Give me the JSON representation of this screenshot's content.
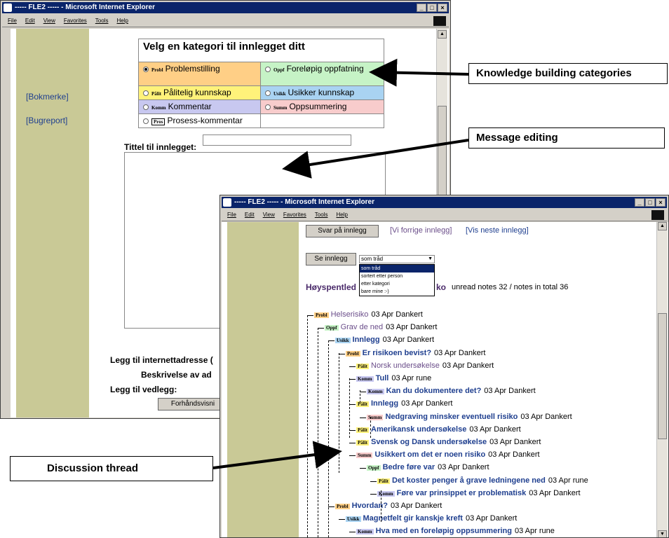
{
  "win1": {
    "title": "----- FLE2 ----- - Microsoft Internet Explorer",
    "menu": [
      "File",
      "Edit",
      "View",
      "Favorites",
      "Tools",
      "Help"
    ],
    "links": [
      "[Bokmerke]",
      "[Bugreport]"
    ],
    "heading": "Velg en kategori til innlegget ditt",
    "categories": [
      {
        "tag": "Probl",
        "label": "Problemstilling",
        "color": "#ffcf86",
        "selected": true
      },
      {
        "tag": "Oppf",
        "label": "Foreløpig oppfatning",
        "color": "#c6f3c6"
      },
      {
        "tag": "Pålit",
        "label": "Pålitelig kunnskap",
        "color": "#fff27a"
      },
      {
        "tag": "Usikk",
        "label": "Usikker kunnskap",
        "color": "#a9d3f2"
      },
      {
        "tag": "Komm",
        "label": "Kommentar",
        "color": "#c8c8f0"
      },
      {
        "tag": "Summ",
        "label": "Oppsummering",
        "color": "#f8cccc"
      },
      {
        "tag": "Pros",
        "label": "Prosess-kommentar",
        "color": "#ffffff"
      }
    ],
    "title_label": "Tittel til innlegget:",
    "url_label": "Legg til internettadresse (",
    "desc_label": "Beskrivelse av ad",
    "attach_label": "Legg til vedlegg:",
    "preview_btn": "Forhåndsvisni"
  },
  "win2": {
    "title": "----- FLE2 ----- - Microsoft Internet Explorer",
    "menu": [
      "File",
      "Edit",
      "View",
      "Favorites",
      "Tools",
      "Help"
    ],
    "reply_btn": "Svar på innlegg",
    "prev_link": "[Vi forrige innlegg]",
    "next_link": "[Vis neste innlegg]",
    "view_btn": "Se innlegg",
    "select_value": "som tråd",
    "options": [
      "som tråd",
      "sortert etter person",
      "etter kategori",
      "bare mine :-)"
    ],
    "heading": "Høyspentled",
    "heading_tail": "ko",
    "unread": "unread notes 32 / notes in total 36",
    "thread": [
      {
        "tag": "Probl",
        "title": "Helserisiko",
        "meta": "03 Apr Dankert",
        "read": true
      },
      {
        "tag": "Oppf",
        "title": "Grav de ned",
        "meta": "03 Apr Dankert",
        "read": true
      },
      {
        "tag": "Usikk",
        "title": "Innlegg",
        "meta": "03 Apr Dankert"
      },
      {
        "tag": "Probl",
        "title": "Er risikoen bevist?",
        "meta": "03 Apr Dankert"
      },
      {
        "tag": "Pålit",
        "title": "Norsk undersøkelse",
        "meta": "03 Apr Dankert",
        "read": true
      },
      {
        "tag": "Komm",
        "title": "Tull",
        "meta": "03 Apr rune"
      },
      {
        "tag": "Komm",
        "title": "Kan du dokumentere det?",
        "meta": "03 Apr Dankert"
      },
      {
        "tag": "Pålit",
        "title": "Innlegg",
        "meta": "03 Apr Dankert"
      },
      {
        "tag": "Summ",
        "title": "Nedgraving minsker eventuell risiko",
        "meta": "03 Apr Dankert"
      },
      {
        "tag": "Pålit",
        "title": "Amerikansk undersøkelse",
        "meta": "03 Apr Dankert"
      },
      {
        "tag": "Pålit",
        "title": "Svensk og Dansk undersøkelse",
        "meta": "03 Apr Dankert"
      },
      {
        "tag": "Summ",
        "title": "Usikkert om det er noen risiko",
        "meta": "03 Apr Dankert"
      },
      {
        "tag": "Oppf",
        "title": "Bedre føre var",
        "meta": "03 Apr Dankert"
      },
      {
        "tag": "Pålit",
        "title": "Det koster penger å grave ledningene ned",
        "meta": "03 Apr rune"
      },
      {
        "tag": "Komm",
        "title": "Føre var prinsippet er problematisk",
        "meta": "03 Apr Dankert"
      },
      {
        "tag": "Probl",
        "title": "Hvordan?",
        "meta": "03 Apr Dankert"
      },
      {
        "tag": "Usikk",
        "title": "Magnetfelt gir kanskje kreft",
        "meta": "03 Apr Dankert"
      },
      {
        "tag": "Komm",
        "title": "Hva med en foreløpig oppsummering",
        "meta": "03 Apr rune"
      }
    ]
  },
  "callouts": {
    "kb": "Knowledge building categories",
    "edit": "Message editing",
    "thread": "Discussion thread"
  }
}
